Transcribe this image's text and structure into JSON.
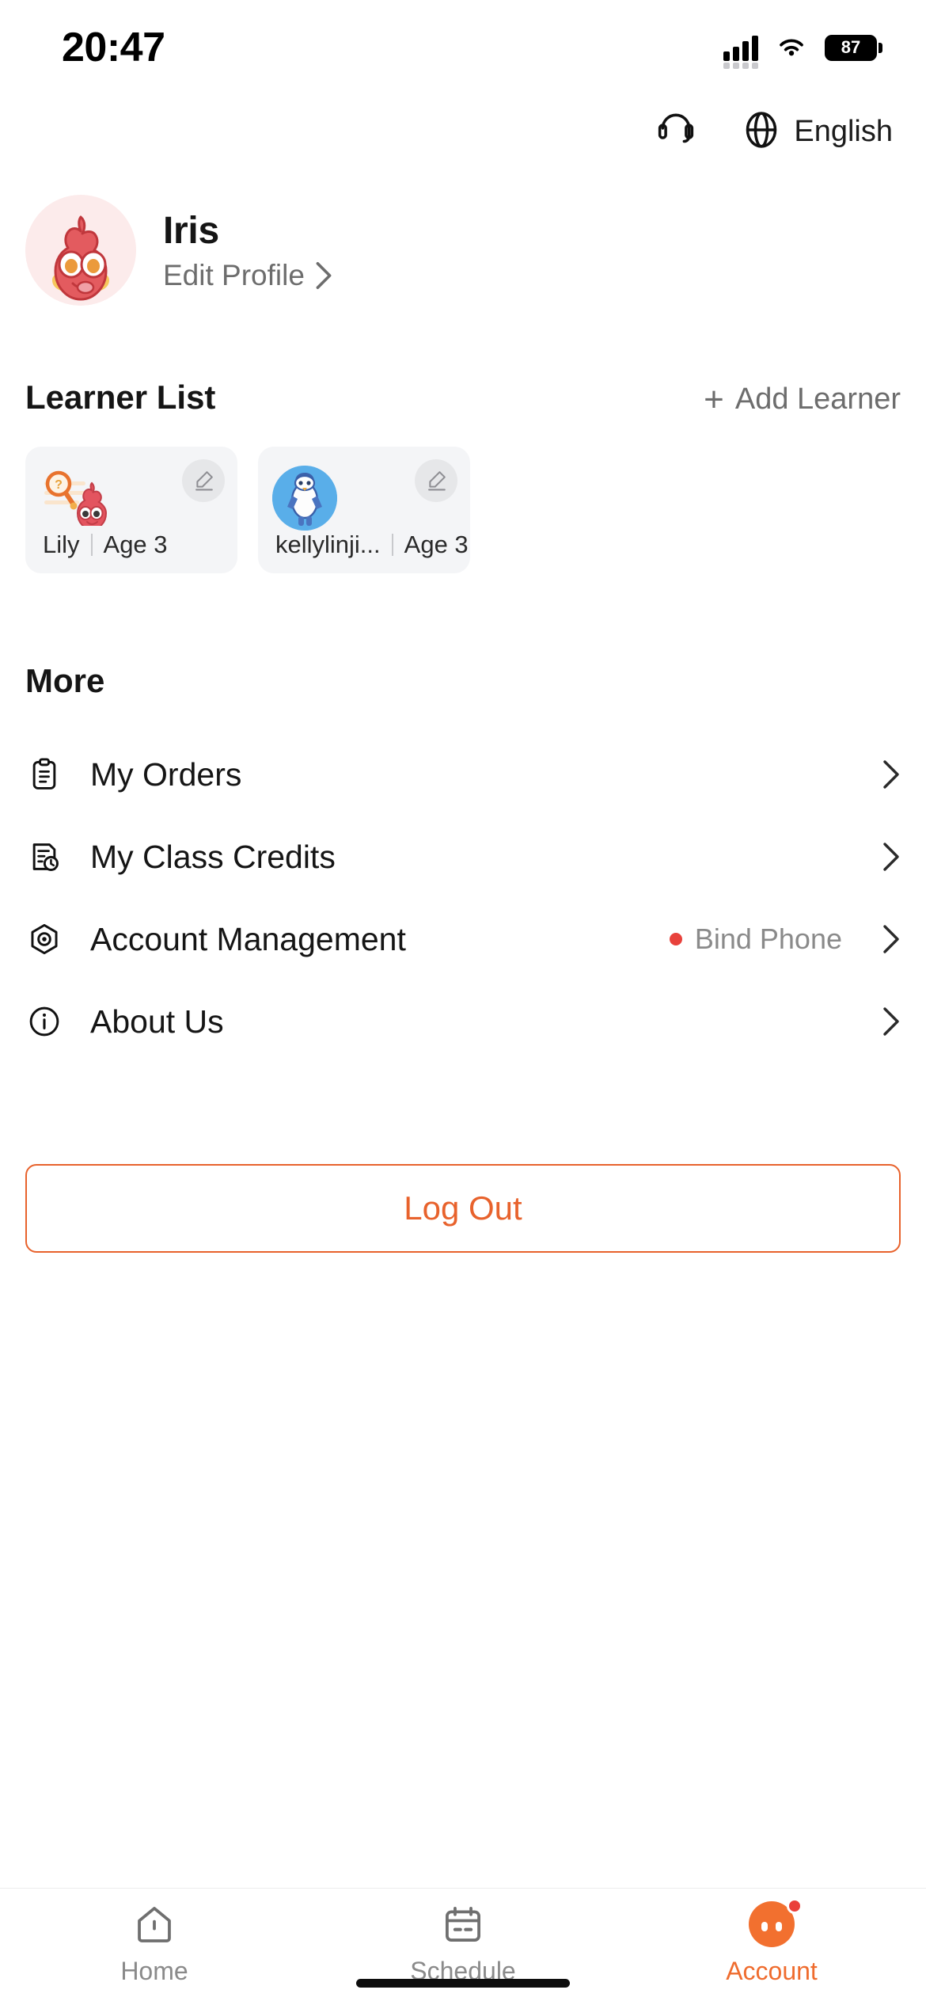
{
  "status_bar": {
    "time": "20:47",
    "battery_level": "87",
    "signal_icon": "cellular-signal-icon",
    "wifi_icon": "wifi-icon",
    "battery_icon": "battery-icon"
  },
  "top_bar": {
    "support_icon": "headset-icon",
    "globe_icon": "globe-icon",
    "language_label": "English"
  },
  "profile": {
    "name": "Iris",
    "edit_label": "Edit Profile",
    "chevron_icon": "chevron-right-icon",
    "avatar_icon": "flame-character-avatar"
  },
  "learner_section": {
    "title": "Learner List",
    "add_label": "Add Learner",
    "add_icon": "plus-icon",
    "cards": [
      {
        "name": "Lily",
        "age": "Age 3",
        "edit_icon": "pencil-icon",
        "avatar_icon": "magnifier-flame-icon"
      },
      {
        "name": "kellylinji...",
        "age": "Age 3",
        "edit_icon": "pencil-icon",
        "avatar_icon": "blue-penguin-avatar"
      }
    ]
  },
  "more_section": {
    "title": "More",
    "items": [
      {
        "label": "My Orders",
        "icon": "clipboard-icon",
        "extra": "",
        "has_dot": false
      },
      {
        "label": "My Class Credits",
        "icon": "document-clock-icon",
        "extra": "",
        "has_dot": false
      },
      {
        "label": "Account Management",
        "icon": "target-hexagon-icon",
        "extra": "Bind Phone",
        "has_dot": true
      },
      {
        "label": "About Us",
        "icon": "info-circle-icon",
        "extra": "",
        "has_dot": false
      }
    ]
  },
  "logout": {
    "label": "Log Out"
  },
  "tabbar": {
    "items": [
      {
        "label": "Home",
        "icon": "home-icon",
        "active": false
      },
      {
        "label": "Schedule",
        "icon": "calendar-icon",
        "active": false
      },
      {
        "label": "Account",
        "icon": "account-avatar-icon",
        "active": true
      }
    ]
  },
  "colors": {
    "accent": "#ef6c2e",
    "logout_border": "#e8622c",
    "badge": "#ea3f3a",
    "card_bg": "#f4f5f7",
    "muted_text": "#8a8a8a"
  }
}
